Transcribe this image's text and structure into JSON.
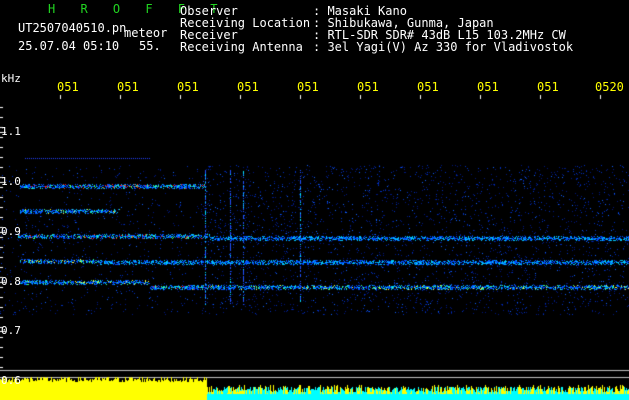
{
  "header": {
    "brand": "H R O F F T",
    "file_name": "UT2507040510.pn",
    "file_suffix": "meteor",
    "datetime": "25.07.04 05:10",
    "count": "55.",
    "fields": [
      {
        "label": "Observer",
        "value": ": Masaki Kano"
      },
      {
        "label": "Receiving Location",
        "value": ": Shibukawa, Gunma, Japan"
      },
      {
        "label": "Receiver",
        "value": ": RTL-SDR SDR# 43dB L15 103.2MHz CW"
      },
      {
        "label": "Receiving Antenna",
        "value": ": 3el Yagi(V) Az 330 for Vladivostok"
      }
    ]
  },
  "chart_data": {
    "type": "heatmap",
    "y_unit_label": "kHz",
    "y_ticks": [
      "1.1",
      "1.0",
      "0.9",
      "0.8",
      "0.7",
      "0.6"
    ],
    "ylim": [
      0.6,
      1.1
    ],
    "x_ticks": [
      "051",
      "051",
      "051",
      "051",
      "051",
      "051",
      "051",
      "051",
      "051",
      "0520"
    ],
    "colors": {
      "background": "#000000",
      "low": "#0000a0",
      "mid": "#00c8ff",
      "high": "#ff2020",
      "bar_early": "#ffff00",
      "bar_late": "#00ffff"
    }
  }
}
